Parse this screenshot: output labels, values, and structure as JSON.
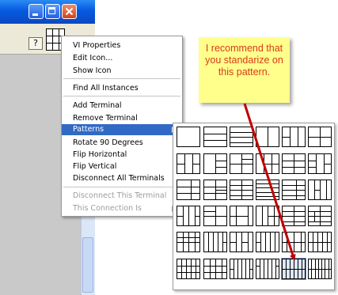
{
  "toolbar": {
    "help_label": "?"
  },
  "menu": {
    "items": [
      {
        "label": "VI Properties",
        "state": "normal",
        "submenu": false
      },
      {
        "label": "Edit Icon...",
        "state": "normal",
        "submenu": false
      },
      {
        "label": "Show Icon",
        "state": "normal",
        "submenu": false
      },
      {
        "label": "Find All Instances",
        "state": "normal",
        "submenu": false
      },
      {
        "label": "Add Terminal",
        "state": "normal",
        "submenu": false
      },
      {
        "label": "Remove Terminal",
        "state": "normal",
        "submenu": false
      },
      {
        "label": "Patterns",
        "state": "selected",
        "submenu": true
      },
      {
        "label": "Rotate 90 Degrees",
        "state": "normal",
        "submenu": false
      },
      {
        "label": "Flip Horizontal",
        "state": "normal",
        "submenu": false
      },
      {
        "label": "Flip Vertical",
        "state": "normal",
        "submenu": false
      },
      {
        "label": "Disconnect All Terminals",
        "state": "normal",
        "submenu": false
      },
      {
        "label": "Disconnect This Terminal",
        "state": "disabled",
        "submenu": false
      },
      {
        "label": "This Connection Is",
        "state": "disabled",
        "submenu": true
      }
    ]
  },
  "note": {
    "text": "I recommend that you standarize on this pattern."
  },
  "palette": {
    "rows": 6,
    "columns": 6,
    "highlighted": {
      "row": 5,
      "column": 4
    }
  },
  "colors": {
    "menu_selected": "#316ac5",
    "note_background": "#ffff8c",
    "note_text": "#d93a18",
    "arrow": "#c00000"
  }
}
